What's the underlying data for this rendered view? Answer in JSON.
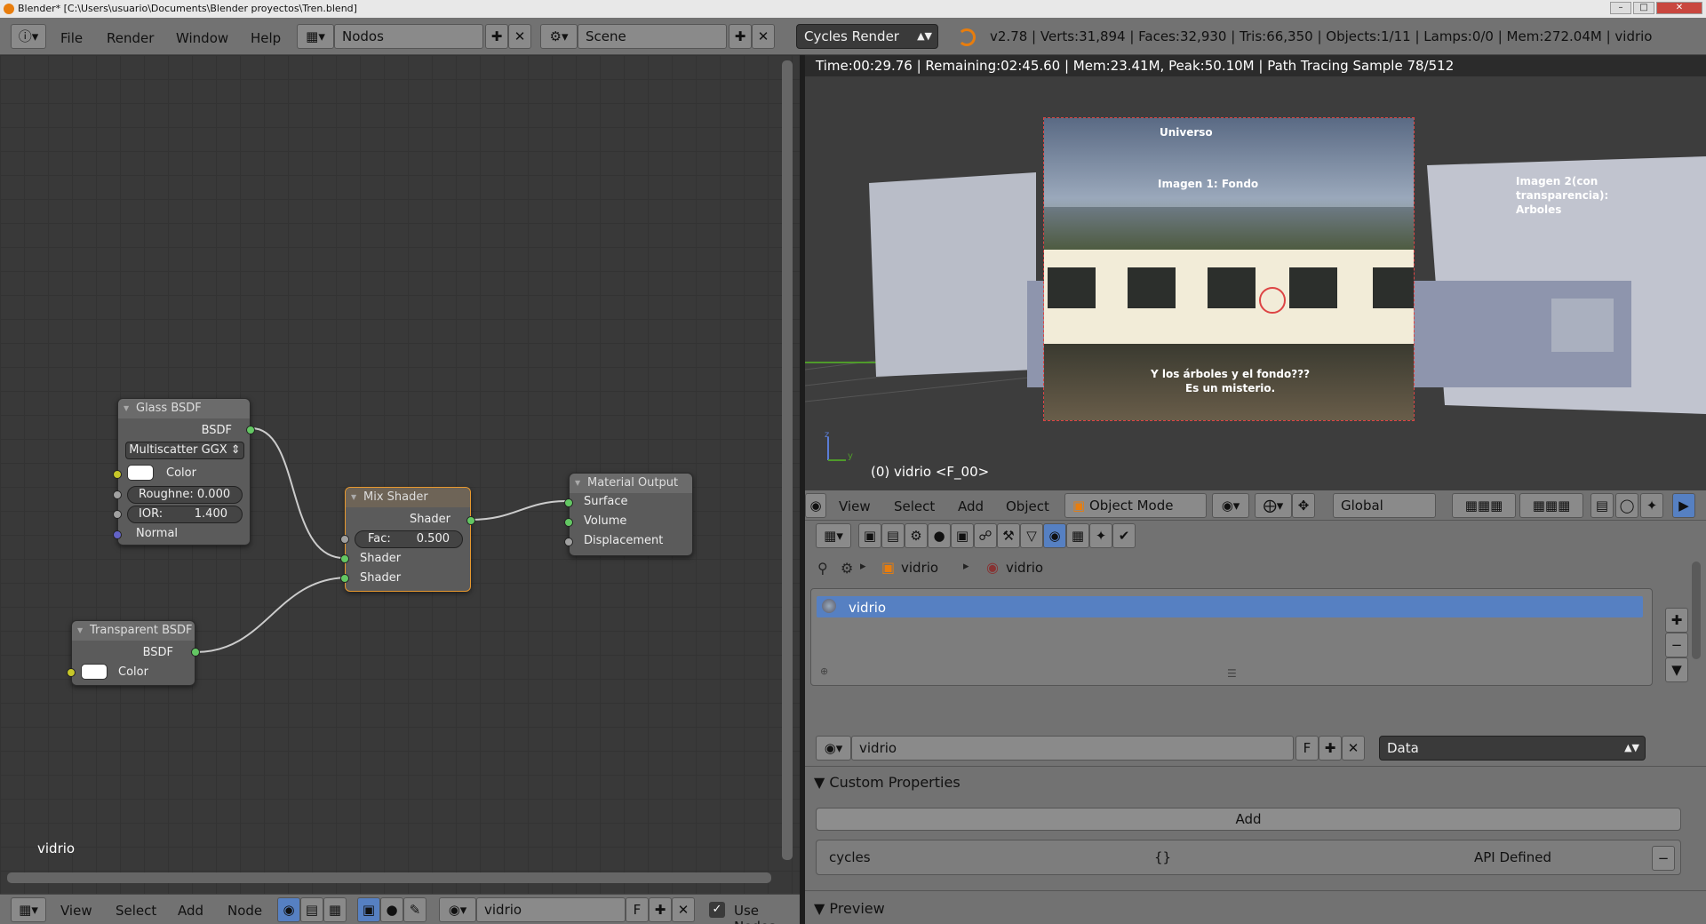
{
  "window": {
    "title": "Blender* [C:\\Users\\usuario\\Documents\\Blender proyectos\\Tren.blend]"
  },
  "info_header": {
    "menus": [
      "File",
      "Render",
      "Window",
      "Help"
    ],
    "screen_layout": "Nodos",
    "scene": "Scene",
    "render_engine": "Cycles Render",
    "stats": "v2.78 | Verts:31,894 | Faces:32,930 | Tris:66,350 | Objects:1/11 | Lamps:0/0 | Mem:272.04M | vidrio"
  },
  "node_editor": {
    "material_label": "vidrio",
    "nodes": {
      "glass": {
        "title": "Glass BSDF",
        "output": "BSDF",
        "distribution": "Multiscatter GGX",
        "color_label": "Color",
        "roughness_label": "Roughne:",
        "roughness_value": "0.000",
        "ior_label": "IOR:",
        "ior_value": "1.400",
        "normal_label": "Normal"
      },
      "transparent": {
        "title": "Transparent BSDF",
        "output": "BSDF",
        "color_label": "Color"
      },
      "mix": {
        "title": "Mix Shader",
        "output": "Shader",
        "fac_label": "Fac:",
        "fac_value": "0.500",
        "input1": "Shader",
        "input2": "Shader"
      },
      "output": {
        "title": "Material Output",
        "surface": "Surface",
        "volume": "Volume",
        "displacement": "Displacement"
      }
    },
    "footer": {
      "menus": [
        "View",
        "Select",
        "Add",
        "Node"
      ],
      "material": "vidrio",
      "fake_user": "F",
      "use_nodes": "Use Nodes"
    }
  },
  "viewport": {
    "render_status": "Time:00:29.76 | Remaining:02:45.60 | Mem:23.41M, Peak:50.10M | Path Tracing Sample 78/512",
    "object_label": "(0) vidrio <F_00>",
    "annotations": {
      "universo": "Universo",
      "imagen1": "Imagen 1: Fondo",
      "imagen2": [
        "Imagen 2(con",
        "transparencia):",
        "Arboles"
      ],
      "question": [
        "Y los árboles y el fondo???",
        "Es un misterio."
      ]
    },
    "axis": {
      "z": "z",
      "y": "y"
    },
    "footer": {
      "menus": [
        "View",
        "Select",
        "Add",
        "Object"
      ],
      "mode": "Object Mode",
      "orientation": "Global"
    }
  },
  "properties": {
    "breadcrumb": [
      "vidrio",
      "vidrio"
    ],
    "slot_item": "vidrio",
    "material_name": "vidrio",
    "fake_user": "F",
    "link_mode": "Data",
    "custom_properties": {
      "title": "Custom Properties",
      "add_label": "Add",
      "prop_name": "cycles",
      "prop_value": "{}",
      "prop_type": "API Defined"
    },
    "preview_title": "Preview"
  },
  "colors": {
    "selection_blue": "#5680c2",
    "node_selected": "#e8992e",
    "socket_shader": "#63c763",
    "socket_color": "#c7c729",
    "socket_vector": "#6363c7"
  }
}
